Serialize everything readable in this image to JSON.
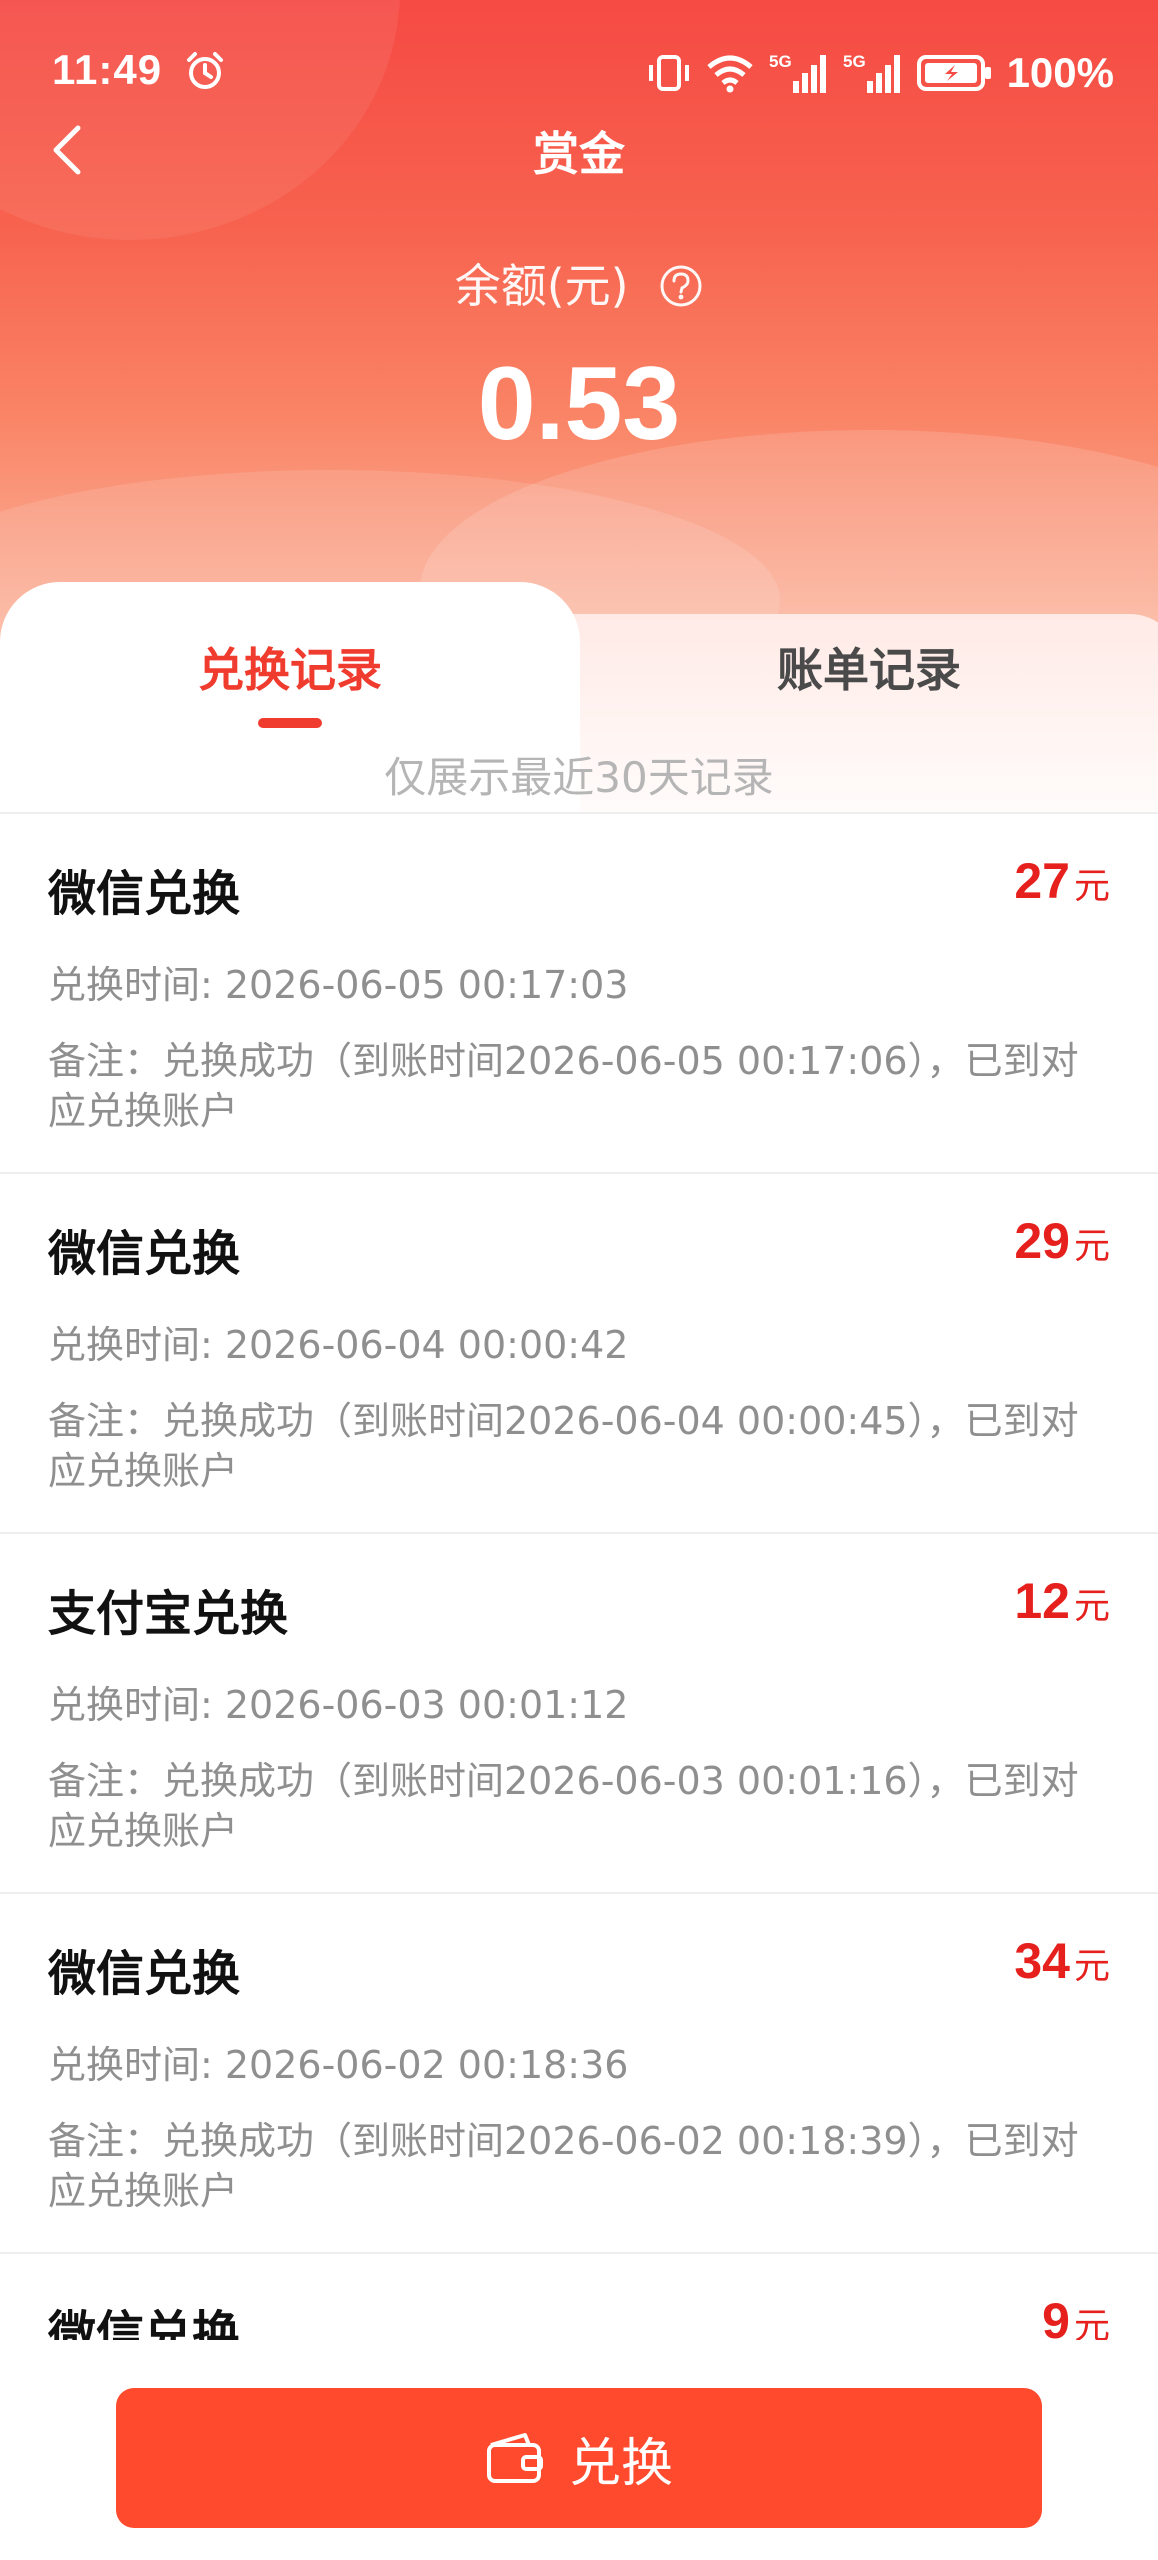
{
  "status_bar": {
    "time": "11:49",
    "battery": "100%",
    "icons": [
      "alarm-icon",
      "vibrate-icon",
      "wifi-icon",
      "5g-signal-icon",
      "5g-signal-icon",
      "battery-charging-icon"
    ]
  },
  "nav": {
    "title": "赏金",
    "back_icon": "chevron-left-icon"
  },
  "balance": {
    "label": "余额(元)",
    "value": "0.53",
    "help_icon": "question-circle-icon"
  },
  "tabs": [
    {
      "label": "兑换记录",
      "active": true
    },
    {
      "label": "账单记录",
      "active": false
    }
  ],
  "notice": "仅展示最近30天记录",
  "records": [
    {
      "title": "微信兑换",
      "amount": "27",
      "unit": "元",
      "time": "兑换时间: 2026-06-05 00:17:03",
      "note": "备注：兑换成功（到账时间2026-06-05 00:17:06），已到对应兑换账户"
    },
    {
      "title": "微信兑换",
      "amount": "29",
      "unit": "元",
      "time": "兑换时间: 2026-06-04 00:00:42",
      "note": "备注：兑换成功（到账时间2026-06-04 00:00:45），已到对应兑换账户"
    },
    {
      "title": "支付宝兑换",
      "amount": "12",
      "unit": "元",
      "time": "兑换时间: 2026-06-03 00:01:12",
      "note": "备注：兑换成功（到账时间2026-06-03 00:01:16），已到对应兑换账户"
    },
    {
      "title": "微信兑换",
      "amount": "34",
      "unit": "元",
      "time": "兑换时间: 2026-06-02 00:18:36",
      "note": "备注：兑换成功（到账时间2026-06-02 00:18:39），已到对应兑换账户"
    },
    {
      "title": "微信兑换",
      "amount": "9",
      "unit": "元"
    }
  ],
  "bottom_button": {
    "label": "兑换",
    "icon": "wallet-icon"
  },
  "colors": {
    "header_top": "#f64a44",
    "accent_red": "#f03c2e",
    "amount_red": "#e5201d",
    "button": "#ff4a2d"
  }
}
